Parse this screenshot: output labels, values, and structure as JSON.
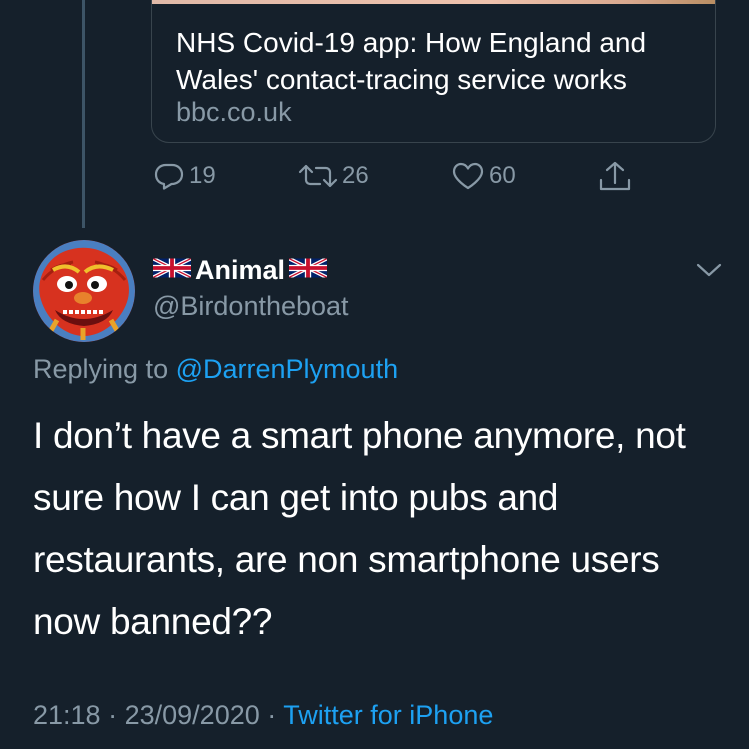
{
  "link_card": {
    "title": "NHS Covid-19 app: How England and Wales' contact-tracing service works",
    "domain": "bbc.co.uk"
  },
  "actions": {
    "replies": "19",
    "retweets": "26",
    "likes": "60"
  },
  "reply": {
    "name": "Animal",
    "handle": "@Birdontheboat",
    "replying_prefix": "Replying to",
    "replying_to": "@DarrenPlymouth",
    "text": "I don’t have a smart phone anymore, not sure how I can get into pubs and restaurants, are non smartphone users now banned??",
    "time": "21:18",
    "dot1": "·",
    "date": "23/09/2020",
    "dot2": "·",
    "source": "Twitter for iPhone"
  },
  "colors": {
    "background": "#15202b",
    "secondary_text": "#8899a6",
    "link": "#1da1f2",
    "border": "#38444d"
  },
  "icons": [
    "reply-icon",
    "retweet-icon",
    "like-icon",
    "share-icon",
    "uk-flag-icon",
    "chevron-down-icon"
  ]
}
